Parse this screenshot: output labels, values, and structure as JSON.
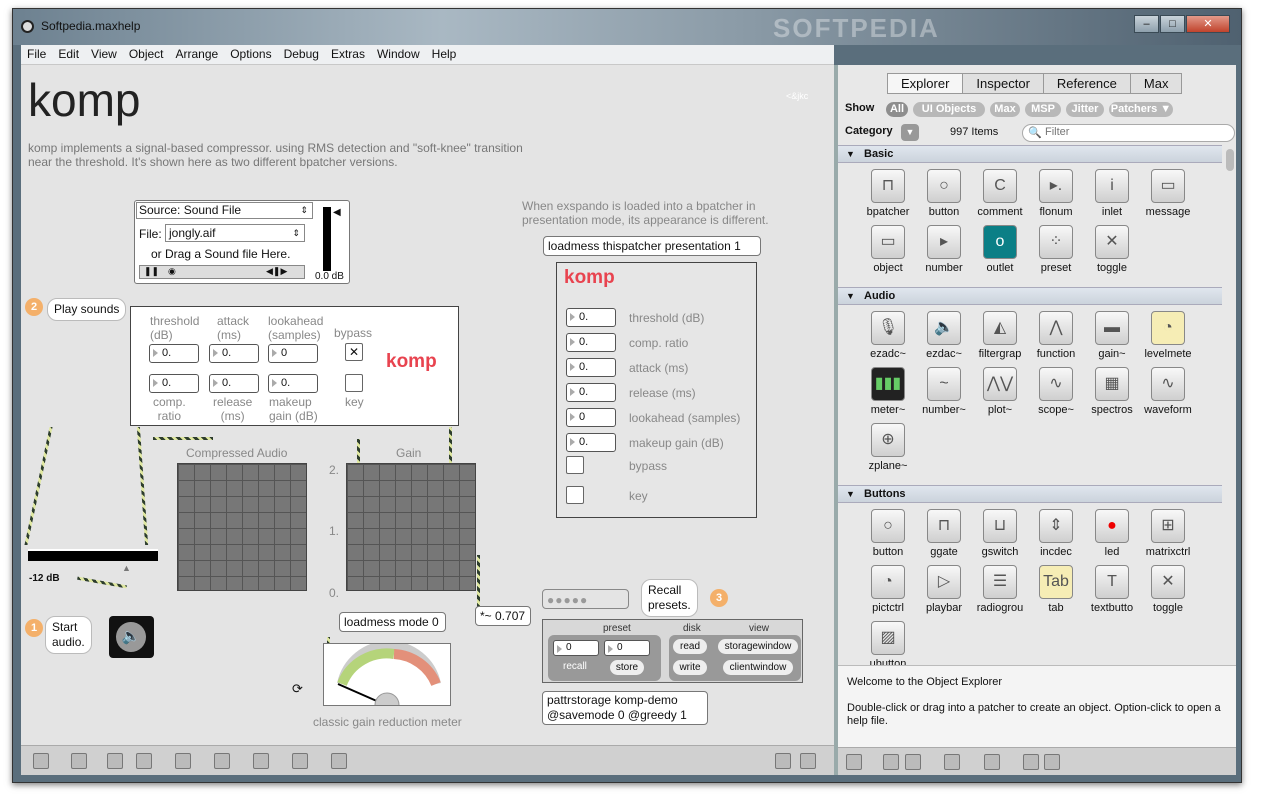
{
  "window": {
    "title": "Softpedia.maxhelp",
    "minimize": "–",
    "maximize": "□",
    "close": "✕"
  },
  "menu": [
    "File",
    "Edit",
    "View",
    "Object",
    "Arrange",
    "Options",
    "Debug",
    "Extras",
    "Window",
    "Help"
  ],
  "patcher": {
    "title": "komp",
    "credit": "<&jkc",
    "description": "komp implements a signal-based compressor. using RMS detection and \"soft-knee\" transition near the threshold. It's shown here as two different bpatcher versions.",
    "source_label": "Source: Sound File",
    "file_label": "File:",
    "file_value": "jongly.aif",
    "drag_hint": "or Drag a Sound file Here.",
    "gain_readout": "0.0 dB",
    "play_sounds": "Play sounds",
    "step2": "2",
    "komp_left": {
      "threshold": "threshold\n(dB)",
      "attack": "attack\n(ms)",
      "lookahead": "lookahead\n(samples)",
      "bypass": "bypass",
      "comp_ratio": "comp.\nratio",
      "release": "release\n(ms)",
      "makeup": "makeup\ngain (dB)",
      "key": "key",
      "v1": "0.",
      "v2": "0.",
      "v3": "0",
      "v4": "0.",
      "v5": "0.",
      "v6": "0.",
      "brand": "komp"
    },
    "compressed_audio": "Compressed Audio",
    "gain_label": "Gain",
    "gain_ticks": [
      "2.",
      "1.",
      "0."
    ],
    "meter_db": "-12 dB",
    "start_audio": "Start\naudio.",
    "step1": "1",
    "loadmess_mode": "loadmess mode 0",
    "gain_value": "*~ 0.707",
    "meter_caption": "classic gain reduction meter",
    "exspando_note": "When exspando is loaded into a bpatcher in presentation mode, its appearance is different.",
    "loadmess_pres": "loadmess thispatcher presentation 1",
    "komp_right": {
      "brand": "komp",
      "rows": [
        {
          "value": "0.",
          "label": "threshold (dB)"
        },
        {
          "value": "0.",
          "label": "comp. ratio"
        },
        {
          "value": "0.",
          "label": "attack (ms)"
        },
        {
          "value": "0.",
          "label": "release (ms)"
        },
        {
          "value": "0",
          "label": "lookahead (samples)"
        },
        {
          "value": "0.",
          "label": "makeup gain (dB)"
        }
      ],
      "bypass": "bypass",
      "key": "key"
    },
    "recall_presets": "Recall\npresets.",
    "step3": "3",
    "preset_panel": {
      "preset": "preset",
      "disk": "disk",
      "view": "view",
      "v1": "0",
      "v2": "0",
      "recall": "recall",
      "store": "store",
      "read": "read",
      "write": "write",
      "storagewindow": "storagewindow",
      "clientwindow": "clientwindow"
    },
    "pattrstorage": "pattrstorage komp-demo\n@savemode 0 @greedy 1"
  },
  "explorer": {
    "tabs": [
      "Explorer",
      "Inspector",
      "Reference",
      "Max"
    ],
    "show_label": "Show",
    "filters": [
      "All",
      "UI Objects",
      "Max",
      "MSP",
      "Jitter",
      "Patchers ▼"
    ],
    "category_label": "Category",
    "items_count": "997 Items",
    "filter_placeholder": "Filter",
    "sections": [
      {
        "name": "Basic",
        "items": [
          "bpatcher",
          "button",
          "comment",
          "flonum",
          "inlet",
          "message",
          "object",
          "number",
          "outlet",
          "preset",
          "toggle"
        ]
      },
      {
        "name": "Audio",
        "items": [
          "ezadc~",
          "ezdac~",
          "filtergrap",
          "function",
          "gain~",
          "levelmete",
          "meter~",
          "number~",
          "plot~",
          "scope~",
          "spectros",
          "waveform",
          "zplane~"
        ]
      },
      {
        "name": "Buttons",
        "items": [
          "button",
          "ggate",
          "gswitch",
          "incdec",
          "led",
          "matrixctrl",
          "pictctrl",
          "playbar",
          "radiogrou",
          "tab",
          "textbutto",
          "toggle",
          "ubutton"
        ]
      }
    ],
    "welcome_title": "Welcome to the Object Explorer",
    "welcome_text": "Double-click or drag into a patcher to create an object. Option-click to open a help file."
  },
  "watermark": "SOFTPEDIA"
}
